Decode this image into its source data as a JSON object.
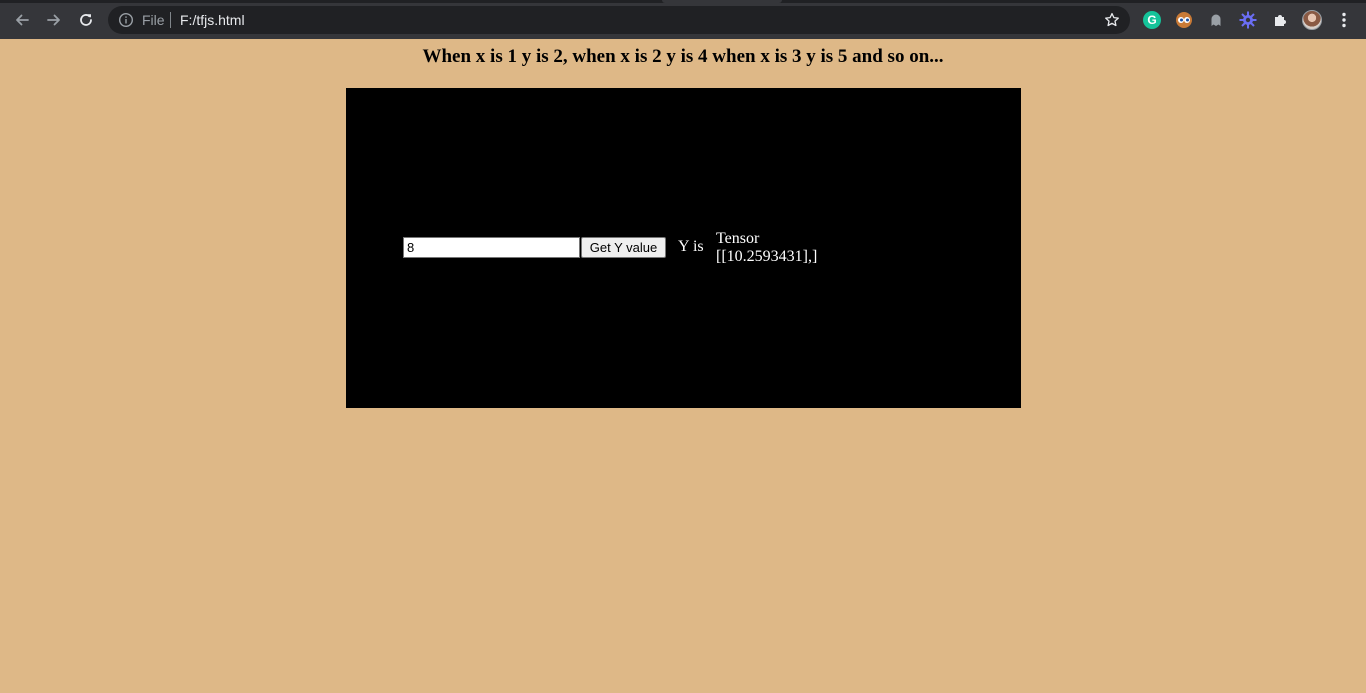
{
  "browser": {
    "omnibox": {
      "scheme_label": "File",
      "url": "F:/tfjs.html"
    },
    "nav_icons": [
      "back-arrow-icon",
      "forward-arrow-icon",
      "reload-icon"
    ],
    "extension_icons": [
      "grammarly-icon",
      "eyes-extension-icon",
      "ghost-extension-icon",
      "gear-extension-icon",
      "puzzle-icon"
    ],
    "grammarly_letter": "G"
  },
  "page": {
    "heading": "When x is 1 y is 2, when x is 2 y is 4 when x is 3 y is 5 and so on...",
    "background_color": "#DEB887",
    "panel_color": "#000000",
    "form": {
      "x_value": "8",
      "button_label": "Get Y value",
      "y_label": "Y is",
      "y_output": "Tensor\n[[10.2593431],]"
    }
  }
}
